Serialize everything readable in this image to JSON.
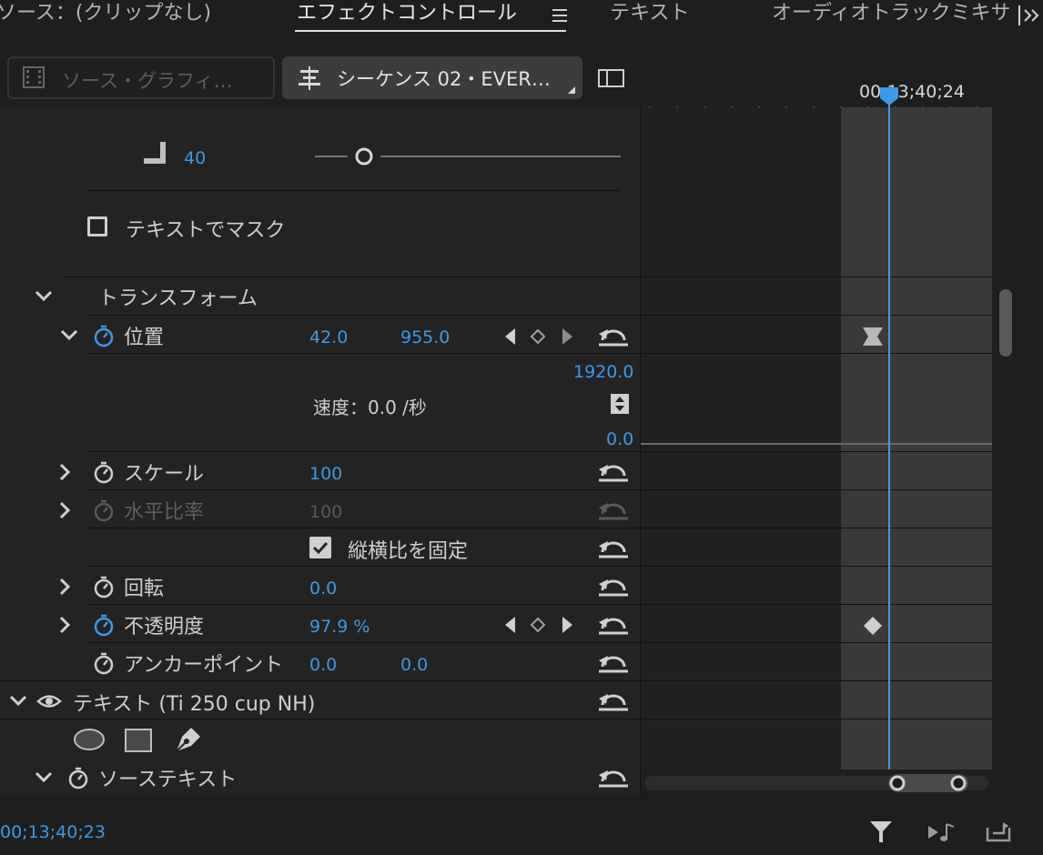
{
  "tabs": [
    {
      "label": "ソース：(クリップなし)"
    },
    {
      "label": "エフェクトコントロール"
    },
    {
      "label": "テキスト"
    },
    {
      "label": "オーディオトラックミキサ"
    }
  ],
  "tab_menu_icon": "hamburger-icon",
  "overflow_icon": "double-chevron-right-icon",
  "source_selector": {
    "label": "ソース・グラフィ…"
  },
  "sequence_selector": {
    "label": "シーケンス 02・EVER…"
  },
  "timeline": {
    "timecode": "00;13;40;24"
  },
  "corner_radius": {
    "value": "40"
  },
  "mask": {
    "label": "テキストでマスク",
    "checked": false
  },
  "transform": {
    "label": "トランスフォーム",
    "position": {
      "label": "位置",
      "x": "42.0",
      "y": "955.0",
      "graph_max": "1920.0",
      "speed": "速度：0.0 /秒",
      "graph_min": "0.0"
    },
    "scale": {
      "label": "スケール",
      "value": "100"
    },
    "scale_width": {
      "label": "水平比率",
      "value": "100"
    },
    "uniform": {
      "label": "縦横比を固定",
      "checked": true
    },
    "rotation": {
      "label": "回転",
      "value": "0.0"
    },
    "opacity": {
      "label": "不透明度",
      "value": "97.9 %"
    },
    "anchor": {
      "label": "アンカーポイント",
      "x": "0.0",
      "y": "0.0"
    }
  },
  "text_layer": {
    "label": "テキスト (Ti 250 cup NH)"
  },
  "source_text": {
    "label": "ソーステキスト"
  },
  "footer": {
    "timecode": "00;13;40;23"
  },
  "colors": {
    "accent": "#3d9ae8",
    "bg": "#1e1e1e",
    "panel": "#232323"
  }
}
